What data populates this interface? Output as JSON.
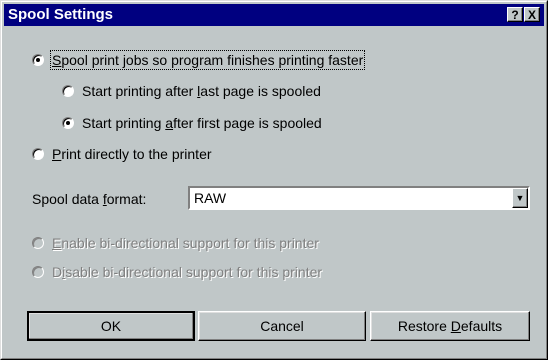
{
  "dialog": {
    "title": "Spool Settings",
    "help_glyph": "?",
    "close_glyph": "X"
  },
  "options": {
    "spool": {
      "pre": "",
      "key": "S",
      "post": "pool print jobs so program finishes printing faster",
      "checked": true
    },
    "after_last": {
      "pre": "Start printing after ",
      "key": "l",
      "post": "ast page is spooled",
      "checked": false
    },
    "after_first": {
      "pre": "Start printing ",
      "key": "a",
      "post": "fter first page is spooled",
      "checked": true
    },
    "direct": {
      "pre": "",
      "key": "P",
      "post": "rint directly to the printer",
      "checked": false
    },
    "enable_bidi": {
      "pre": "",
      "key": "E",
      "post": "nable bi-directional support for this printer",
      "checked": false,
      "disabled": true
    },
    "disable_bidi": {
      "pre": "D",
      "key": "i",
      "post": "sable bi-directional support for this printer",
      "checked": false,
      "disabled": true
    }
  },
  "format": {
    "label_pre": "Spool data ",
    "label_key": "f",
    "label_post": "ormat:",
    "value": "RAW",
    "arrow_glyph": "▼"
  },
  "buttons": {
    "ok": "OK",
    "cancel": "Cancel",
    "restore_pre": "Restore ",
    "restore_key": "D",
    "restore_post": "efaults"
  }
}
